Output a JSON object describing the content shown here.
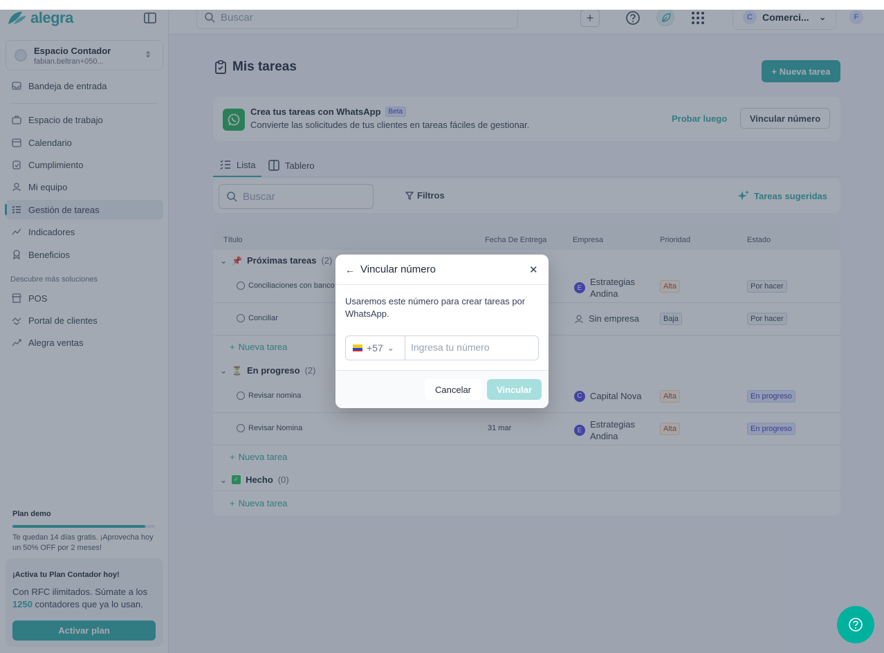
{
  "brand": {
    "name": "alegra",
    "accent": "#30aba9"
  },
  "workspace": {
    "title": "Espacio Contador",
    "subtitle": "fabian.beltran+050..."
  },
  "nav": {
    "inbox": "Bandeja de entrada",
    "items": [
      "Espacio de trabajo",
      "Calendario",
      "Cumplimiento",
      "Mi equipo",
      "Gestión de tareas",
      "Indicadores",
      "Beneficios"
    ],
    "section_label": "Descubre más soluciones",
    "more": [
      "POS",
      "Portal de clientes",
      "Alegra ventas"
    ]
  },
  "plan": {
    "title": "Plan demo",
    "progress": 0.93,
    "text": "Te quedan 14 días gratis. ¡Aprovecha hoy un 50% OFF por 2 meses!",
    "promo_title": "¡Activa tu Plan Contador hoy!",
    "promo_text_a": "Con RFC ilimitados. Súmate a los",
    "promo_number": "1250",
    "promo_text_b": "contadores que ya lo usan.",
    "promo_button": "Activar plan"
  },
  "topbar": {
    "search_placeholder": "Buscar",
    "company": "Comerci...",
    "company_initial": "C",
    "user_initial": "F"
  },
  "page": {
    "title": "Mis tareas",
    "new_task": "+ Nueva tarea"
  },
  "whatsapp_banner": {
    "title": "Crea tus tareas con WhatsApp",
    "badge": "Beta",
    "subtitle": "Convierte las solicitudes de tus clientes en tareas fáciles de gestionar.",
    "later": "Probar luego",
    "link": "Vincular número"
  },
  "tabs": [
    "Lista",
    "Tablero"
  ],
  "filters": {
    "search_placeholder": "Buscar",
    "filters_label": "Filtros",
    "suggested": "Tareas sugeridas"
  },
  "table": {
    "headers": [
      "Título",
      "Fecha De Entrega",
      "Empresa",
      "Prioridad",
      "Estado"
    ],
    "add_task": "Nueva tarea",
    "groups": [
      {
        "name": "Próximas tareas",
        "count": "(2)",
        "rows": [
          {
            "title": "Conciliaciones con banco",
            "date": "",
            "company_initial": "E",
            "company": "Estrategias Andina",
            "priority": "Alta",
            "status": "Por hacer"
          },
          {
            "title": "Conciliar",
            "date": "",
            "company_initial": "",
            "company": "Sin empresa",
            "priority": "Baja",
            "status": "Por hacer"
          }
        ]
      },
      {
        "name": "En progreso",
        "count": "(2)",
        "rows": [
          {
            "title": "Revisar nomina",
            "date": "",
            "company_initial": "C",
            "company": "Capital Nova",
            "priority": "Alta",
            "status": "En progreso"
          },
          {
            "title": "Revisar Nomina",
            "date": "31 mar",
            "company_initial": "E",
            "company": "Estrategias Andina",
            "priority": "Alta",
            "status": "En progreso"
          }
        ]
      },
      {
        "name": "Hecho",
        "count": "(0)",
        "rows": []
      }
    ]
  },
  "modal": {
    "title": "Vincular número",
    "text": "Usaremos este número para crear tareas por WhatsApp.",
    "prefix": "+57",
    "phone_placeholder": "Ingresa tu número",
    "cancel": "Cancelar",
    "confirm": "Vincular"
  }
}
